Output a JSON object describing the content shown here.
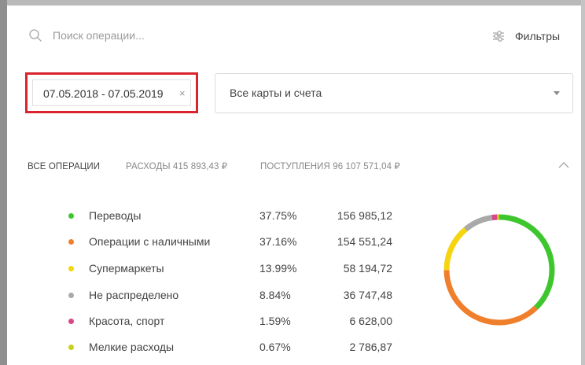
{
  "search": {
    "placeholder": "Поиск операции..."
  },
  "filters": {
    "label": "Фильтры"
  },
  "date_range": {
    "value": "07.05.2018 - 07.05.2019",
    "clear_glyph": "×"
  },
  "account_select": {
    "value": "Все карты и счета"
  },
  "summary_tabs": {
    "all": "ВСЕ ОПЕРАЦИИ",
    "expenses": "РАСХОДЫ 415 893,43 ₽",
    "income": "ПОСТУПЛЕНИЯ 96 107 571,04 ₽"
  },
  "categories": [
    {
      "label": "Переводы",
      "percent": "37.75%",
      "amount": "156 985,12",
      "color": "#3ec62f",
      "share": 37.75
    },
    {
      "label": "Операции с наличными",
      "percent": "37.16%",
      "amount": "154 551,24",
      "color": "#f07f2c",
      "share": 37.16
    },
    {
      "label": "Супермаркеты",
      "percent": "13.99%",
      "amount": "58 194,72",
      "color": "#f5d50f",
      "share": 13.99
    },
    {
      "label": "Не распределено",
      "percent": "8.84%",
      "amount": "36 747,48",
      "color": "#a9a9a9",
      "share": 8.84
    },
    {
      "label": "Красота, спорт",
      "percent": "1.59%",
      "amount": "6 628,00",
      "color": "#d9468a",
      "share": 1.59
    },
    {
      "label": "Мелкие расходы",
      "percent": "0.67%",
      "amount": "2 786,87",
      "color": "#c7d11c",
      "share": 0.67
    }
  ],
  "icons": {
    "search": "search-icon",
    "filters": "filter-sliders-icon",
    "dropdown": "chevron-down-icon",
    "collapse": "chevron-up-icon"
  }
}
